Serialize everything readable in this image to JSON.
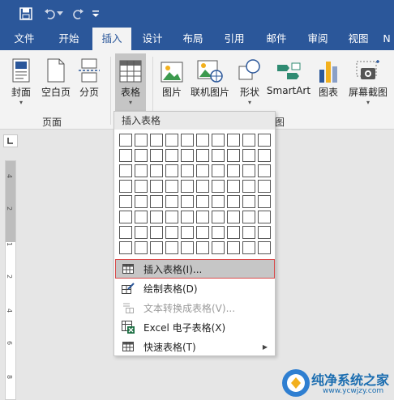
{
  "colors": {
    "accent": "#2b579a",
    "ribbon_bg": "#f3f3f3",
    "highlight_border": "#d94a4a"
  },
  "qat": {
    "save_icon": "save-icon",
    "undo_icon": "undo-icon",
    "redo_icon": "redo-icon",
    "customize_icon": "customize-qat-icon"
  },
  "tabs": [
    {
      "label": "文件"
    },
    {
      "label": "开始"
    },
    {
      "label": "插入"
    },
    {
      "label": "设计"
    },
    {
      "label": "布局"
    },
    {
      "label": "引用"
    },
    {
      "label": "邮件"
    },
    {
      "label": "审阅"
    },
    {
      "label": "视图"
    },
    {
      "label": "N"
    }
  ],
  "ribbon": {
    "pages_group": {
      "label": "页面",
      "cover": "封面",
      "blank_page": "空白页",
      "page_break": "分页"
    },
    "tables_group": {
      "table": "表格"
    },
    "illustrations_group": {
      "label_tail": "图",
      "picture": "图片",
      "online_picture": "联机图片",
      "shapes": "形状",
      "smartart": "SmartArt",
      "chart": "图表",
      "screenshot": "屏幕截图"
    }
  },
  "insert_table_menu": {
    "header": "插入表格",
    "grid": {
      "columns": 10,
      "rows": 8
    },
    "items": [
      {
        "label": "插入表格(I)...",
        "icon": "table-icon"
      },
      {
        "label": "绘制表格(D)",
        "icon": "draw-table-icon"
      },
      {
        "label": "文本转换成表格(V)...",
        "icon": "text-to-table-icon"
      },
      {
        "label": "Excel 电子表格(X)",
        "icon": "excel-icon"
      },
      {
        "label": "快速表格(T)",
        "icon": "quick-tables-icon"
      }
    ]
  },
  "ruler": {
    "numbers": [
      "4",
      "2",
      "1",
      "2",
      "4",
      "6",
      "8"
    ]
  },
  "watermark": {
    "text": "纯净系统之家",
    "url": "www.ycwjzy.com"
  }
}
